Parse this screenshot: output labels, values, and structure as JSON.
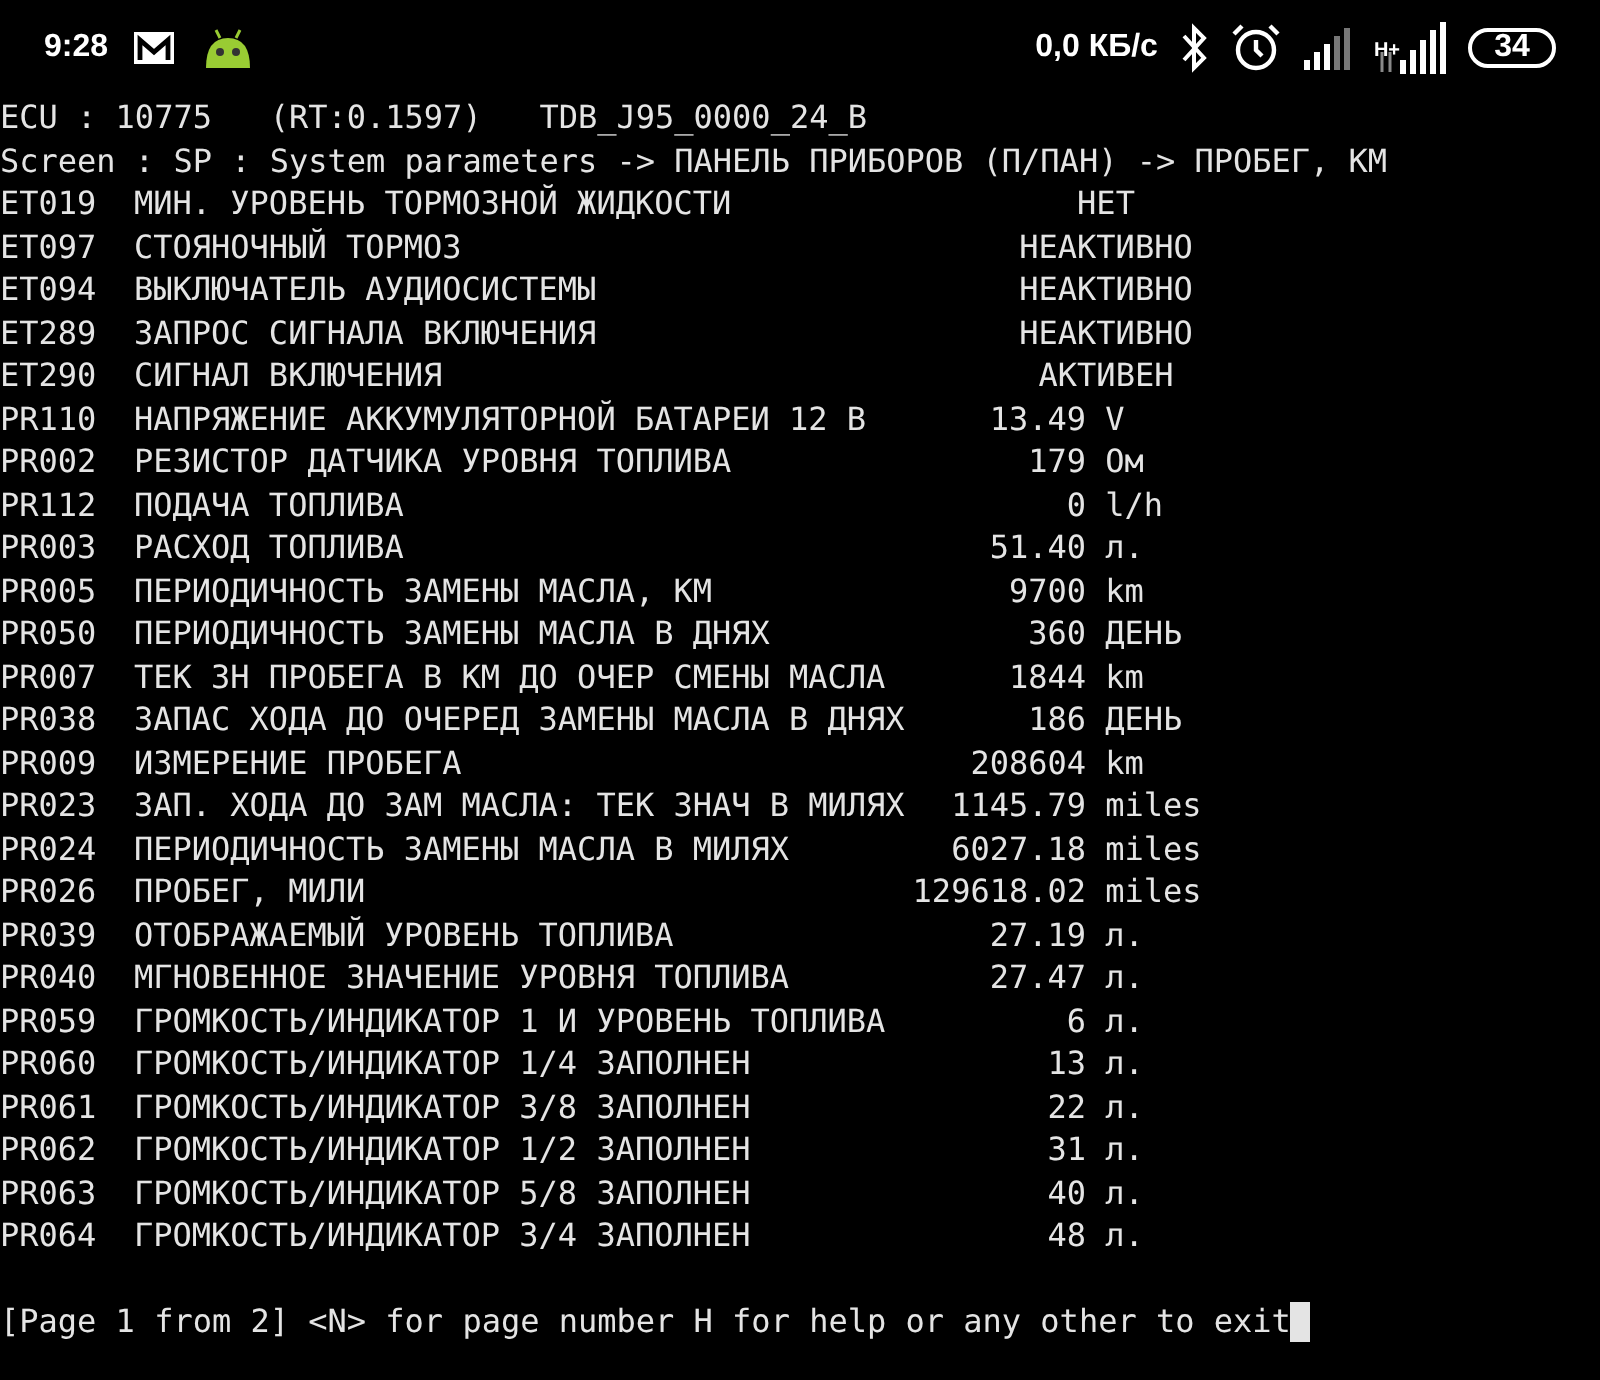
{
  "status_bar": {
    "time": "9:28",
    "network_speed": "0,0 КБ/с",
    "battery": "34",
    "network_type": "H+"
  },
  "terminal": {
    "header": [
      "ECU : 10775   (RT:0.1597)   TDB_J95_0000_24_B",
      "Screen : SP : System parameters -> ПАНЕЛЬ ПРИБОРОВ (П/ПАН) -> ПРОБЕГ, КМ"
    ],
    "rows": [
      {
        "code": "ET019",
        "name": "МИН. УРОВЕНЬ ТОРМОЗНОЙ ЖИДКОСТИ",
        "kind": "state",
        "value": "НЕТ"
      },
      {
        "code": "ET097",
        "name": "СТОЯНОЧНЫЙ ТОРМОЗ",
        "kind": "state",
        "value": "НЕАКТИВНО"
      },
      {
        "code": "ET094",
        "name": "ВЫКЛЮЧАТЕЛЬ АУДИОСИСТЕМЫ",
        "kind": "state",
        "value": "НЕАКТИВНО"
      },
      {
        "code": "ET289",
        "name": "ЗАПРОС СИГНАЛА ВКЛЮЧЕНИЯ",
        "kind": "state",
        "value": "НЕАКТИВНО"
      },
      {
        "code": "ET290",
        "name": "СИГНАЛ ВКЛЮЧЕНИЯ",
        "kind": "state",
        "value": "АКТИВЕН"
      },
      {
        "code": "PR110",
        "name": "НАПРЯЖЕНИЕ АККУМУЛЯТОРНОЙ БАТАРЕИ 12 В",
        "kind": "number",
        "value": "13.49",
        "unit": "V"
      },
      {
        "code": "PR002",
        "name": "РЕЗИСТОР ДАТЧИКА УРОВНЯ ТОПЛИВА",
        "kind": "number",
        "value": "179",
        "unit": "Ом"
      },
      {
        "code": "PR112",
        "name": "ПОДАЧА ТОПЛИВА",
        "kind": "number",
        "value": "0",
        "unit": "l/h"
      },
      {
        "code": "PR003",
        "name": "РАСХОД ТОПЛИВА",
        "kind": "number",
        "value": "51.40",
        "unit": "л."
      },
      {
        "code": "PR005",
        "name": "ПЕРИОДИЧНОСТЬ ЗАМЕНЫ МАСЛА, КМ",
        "kind": "number",
        "value": "9700",
        "unit": "km"
      },
      {
        "code": "PR050",
        "name": "ПЕРИОДИЧНОСТЬ ЗАМЕНЫ МАСЛА В ДНЯХ",
        "kind": "number",
        "value": "360",
        "unit": "ДЕНЬ"
      },
      {
        "code": "PR007",
        "name": "ТЕК ЗН ПРОБЕГА В КМ ДО ОЧЕР СМЕНЫ МАСЛА",
        "kind": "number",
        "value": "1844",
        "unit": "km"
      },
      {
        "code": "PR038",
        "name": "ЗАПАС ХОДА ДО ОЧЕРЕД ЗАМЕНЫ МАСЛА В ДНЯХ",
        "kind": "number",
        "value": "186",
        "unit": "ДЕНЬ"
      },
      {
        "code": "PR009",
        "name": "ИЗМЕРЕНИЕ ПРОБЕГА",
        "kind": "number",
        "value": "208604",
        "unit": "km"
      },
      {
        "code": "PR023",
        "name": "ЗАП. ХОДА ДО ЗАМ МАСЛА: ТЕК ЗНАЧ В МИЛЯХ",
        "kind": "number",
        "value": "1145.79",
        "unit": "miles"
      },
      {
        "code": "PR024",
        "name": "ПЕРИОДИЧНОСТЬ ЗАМЕНЫ МАСЛА В МИЛЯХ",
        "kind": "number",
        "value": "6027.18",
        "unit": "miles"
      },
      {
        "code": "PR026",
        "name": "ПРОБЕГ, МИЛИ",
        "kind": "number",
        "value": "129618.02",
        "unit": "miles"
      },
      {
        "code": "PR039",
        "name": "ОТОБРАЖАЕМЫЙ УРОВЕНЬ ТОПЛИВА",
        "kind": "number",
        "value": "27.19",
        "unit": "л."
      },
      {
        "code": "PR040",
        "name": "МГНОВЕННОЕ ЗНАЧЕНИЕ УРОВНЯ ТОПЛИВА",
        "kind": "number",
        "value": "27.47",
        "unit": "л."
      },
      {
        "code": "PR059",
        "name": "ГРОМКОСТЬ/ИНДИКАТОР 1 И УРОВЕНЬ ТОПЛИВА",
        "kind": "number",
        "value": "6",
        "unit": "л."
      },
      {
        "code": "PR060",
        "name": "ГРОМКОСТЬ/ИНДИКАТОР 1/4 ЗАПОЛНЕН",
        "kind": "number",
        "value": "13",
        "unit": "л."
      },
      {
        "code": "PR061",
        "name": "ГРОМКОСТЬ/ИНДИКАТОР 3/8 ЗАПОЛНЕН",
        "kind": "number",
        "value": "22",
        "unit": "л."
      },
      {
        "code": "PR062",
        "name": "ГРОМКОСТЬ/ИНДИКАТОР 1/2 ЗАПОЛНЕН",
        "kind": "number",
        "value": "31",
        "unit": "л."
      },
      {
        "code": "PR063",
        "name": "ГРОМКОСТЬ/ИНДИКАТОР 5/8 ЗАПОЛНЕН",
        "kind": "number",
        "value": "40",
        "unit": "л."
      },
      {
        "code": "PR064",
        "name": "ГРОМКОСТЬ/ИНДИКАТОР 3/4 ЗАПОЛНЕН",
        "kind": "number",
        "value": "48",
        "unit": "л."
      }
    ],
    "prompt": "[Page 1 from 2] <N> for page number H for help or any other to exit"
  }
}
